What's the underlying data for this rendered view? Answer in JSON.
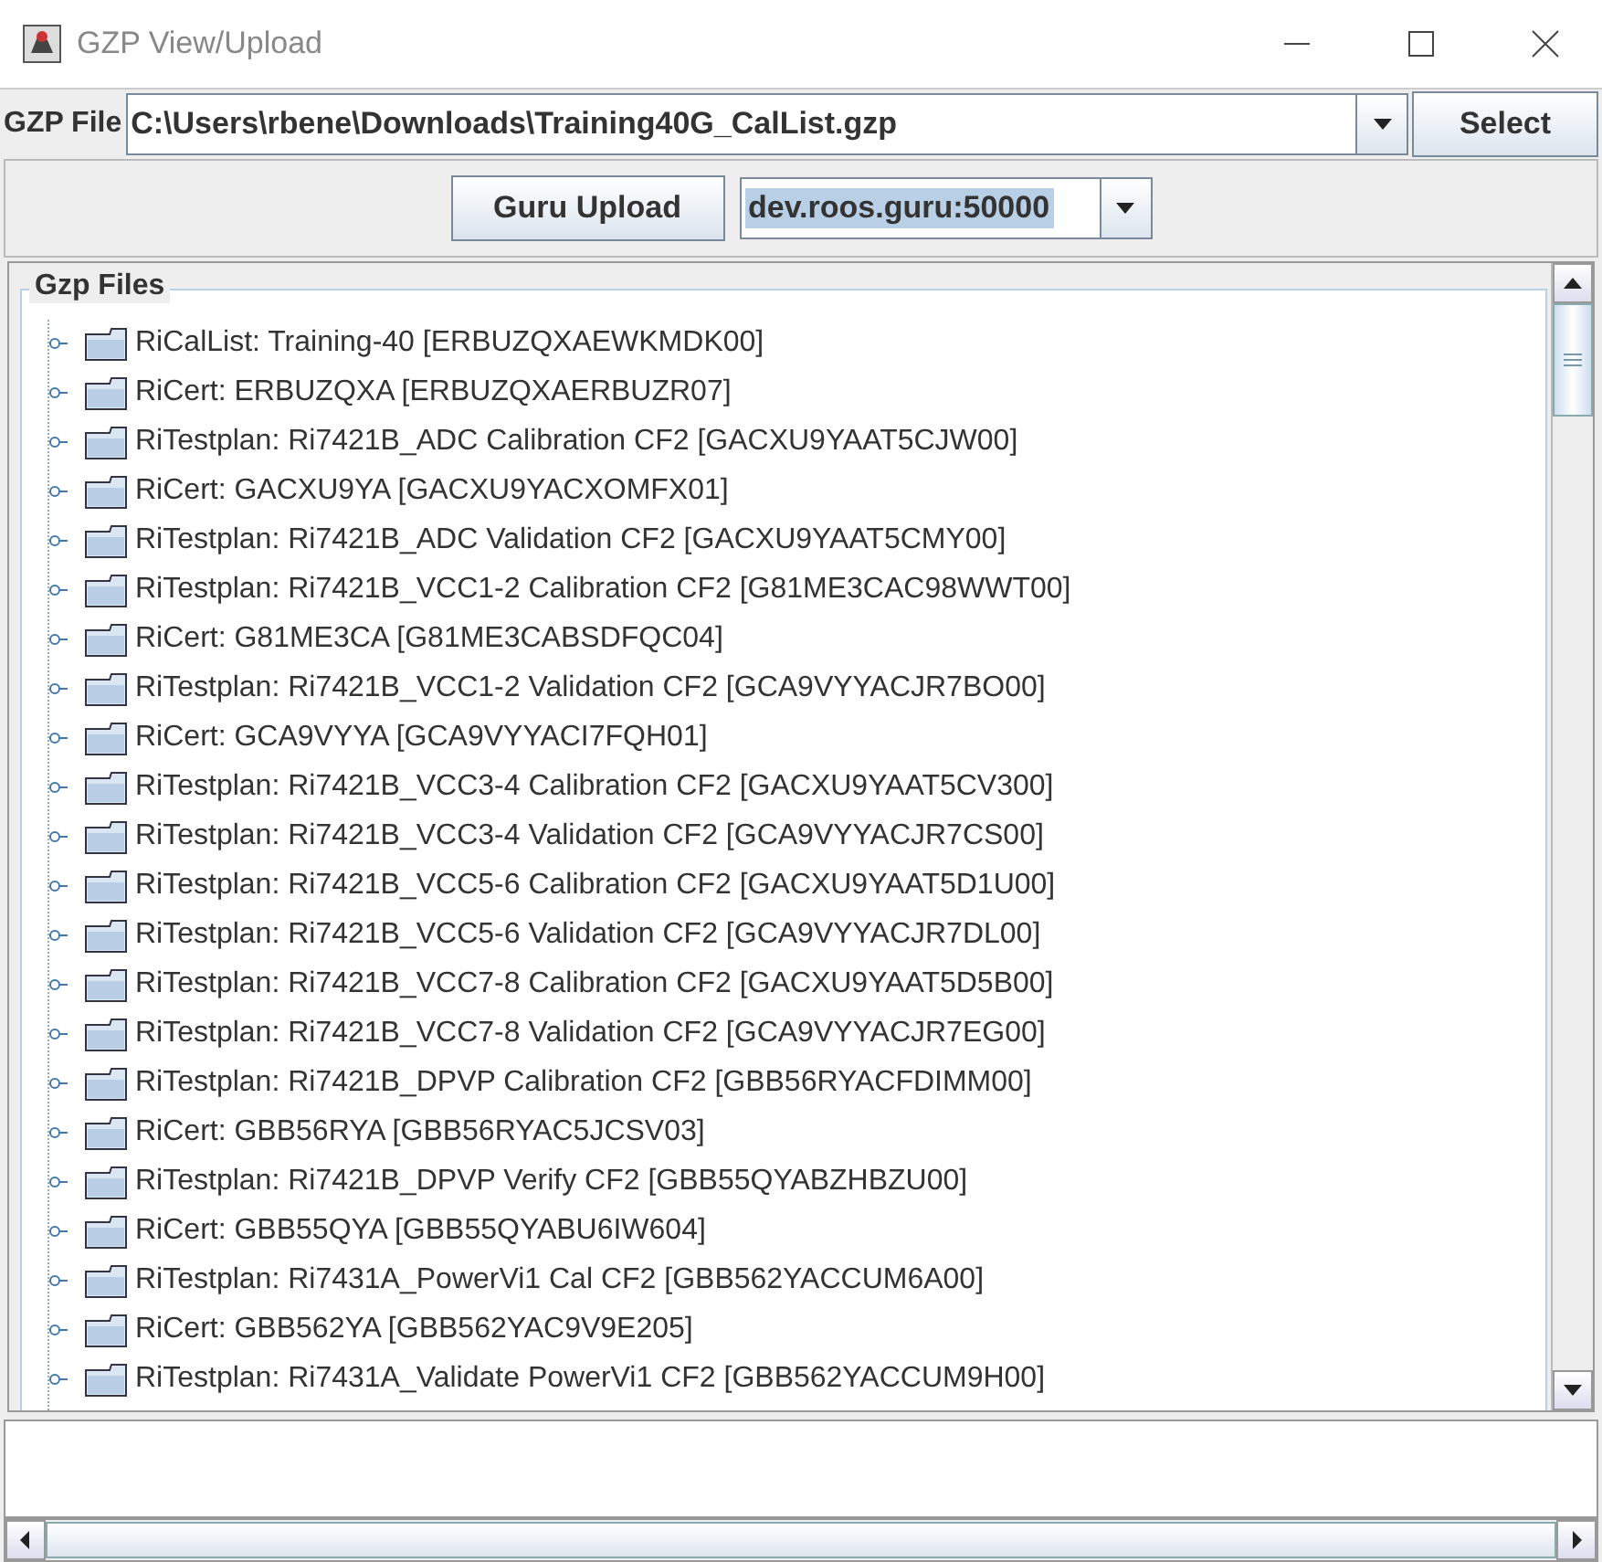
{
  "window": {
    "title": "GZP View/Upload"
  },
  "file_row": {
    "label": "GZP File",
    "path": "C:\\Users\\rbene\\Downloads\\Training40G_CalList.gzp",
    "button": "Select"
  },
  "upload_row": {
    "button": "Guru Upload",
    "server": "dev.roos.guru:50000"
  },
  "tree": {
    "title": "Gzp Files",
    "items": [
      {
        "label": "RiCalList: Training-40 [ERBUZQXAEWKMDK00]"
      },
      {
        "label": "RiCert: ERBUZQXA [ERBUZQXAERBUZR07]"
      },
      {
        "label": "RiTestplan: Ri7421B_ADC Calibration CF2 [GACXU9YAAT5CJW00]"
      },
      {
        "label": "RiCert: GACXU9YA [GACXU9YACXOMFX01]"
      },
      {
        "label": "RiTestplan: Ri7421B_ADC Validation CF2 [GACXU9YAAT5CMY00]"
      },
      {
        "label": "RiTestplan: Ri7421B_VCC1-2 Calibration CF2 [G81ME3CAC98WWT00]"
      },
      {
        "label": "RiCert: G81ME3CA [G81ME3CABSDFQC04]"
      },
      {
        "label": "RiTestplan: Ri7421B_VCC1-2 Validation CF2 [GCA9VYYACJR7BO00]"
      },
      {
        "label": "RiCert: GCA9VYYA [GCA9VYYACI7FQH01]"
      },
      {
        "label": "RiTestplan: Ri7421B_VCC3-4 Calibration CF2 [GACXU9YAAT5CV300]"
      },
      {
        "label": "RiTestplan: Ri7421B_VCC3-4 Validation CF2 [GCA9VYYACJR7CS00]"
      },
      {
        "label": "RiTestplan: Ri7421B_VCC5-6 Calibration CF2 [GACXU9YAAT5D1U00]"
      },
      {
        "label": "RiTestplan: Ri7421B_VCC5-6 Validation CF2 [GCA9VYYACJR7DL00]"
      },
      {
        "label": "RiTestplan: Ri7421B_VCC7-8 Calibration CF2 [GACXU9YAAT5D5B00]"
      },
      {
        "label": "RiTestplan: Ri7421B_VCC7-8 Validation CF2 [GCA9VYYACJR7EG00]"
      },
      {
        "label": "RiTestplan: Ri7421B_DPVP Calibration CF2 [GBB56RYACFDIMM00]"
      },
      {
        "label": "RiCert: GBB56RYA [GBB56RYAC5JCSV03]"
      },
      {
        "label": "RiTestplan: Ri7421B_DPVP Verify CF2 [GBB55QYABZHBZU00]"
      },
      {
        "label": "RiCert: GBB55QYA [GBB55QYABU6IW604]"
      },
      {
        "label": "RiTestplan: Ri7431A_PowerVi1 Cal CF2 [GBB562YACCUM6A00]"
      },
      {
        "label": "RiCert: GBB562YA [GBB562YAC9V9E205]"
      },
      {
        "label": "RiTestplan: Ri7431A_Validate PowerVi1 CF2 [GBB562YACCUM9H00]"
      }
    ]
  }
}
